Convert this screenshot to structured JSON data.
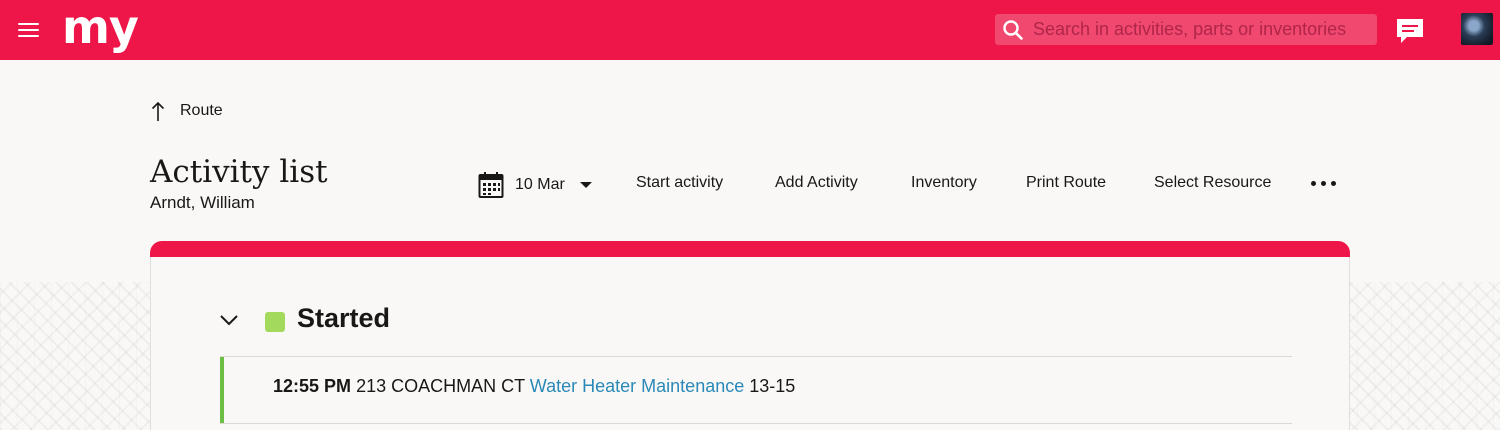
{
  "header": {
    "logo": "my",
    "search_placeholder": "Search in activities, parts or inventories",
    "colors": {
      "brand": "#ee1548"
    }
  },
  "breadcrumb": {
    "label": "Route"
  },
  "page": {
    "title": "Activity list",
    "subtitle": "Arndt, William"
  },
  "toolbar": {
    "date": "10 Mar",
    "buttons": [
      "Start activity",
      "Add Activity",
      "Inventory",
      "Print Route",
      "Select Resource"
    ]
  },
  "groups": [
    {
      "title": "Started",
      "color": "#a3da5d",
      "activities": [
        {
          "time": "12:55 PM",
          "address": "213 COACHMAN CT",
          "type": "Water Heater Maintenance",
          "window": "13-15",
          "bar_color": "#6dbe45"
        }
      ]
    }
  ],
  "icons": [
    "menu-icon",
    "search-icon",
    "chat-icon",
    "arrow-up-icon",
    "calendar-icon",
    "caret-down-icon",
    "more-icon",
    "chevron-down-icon"
  ]
}
